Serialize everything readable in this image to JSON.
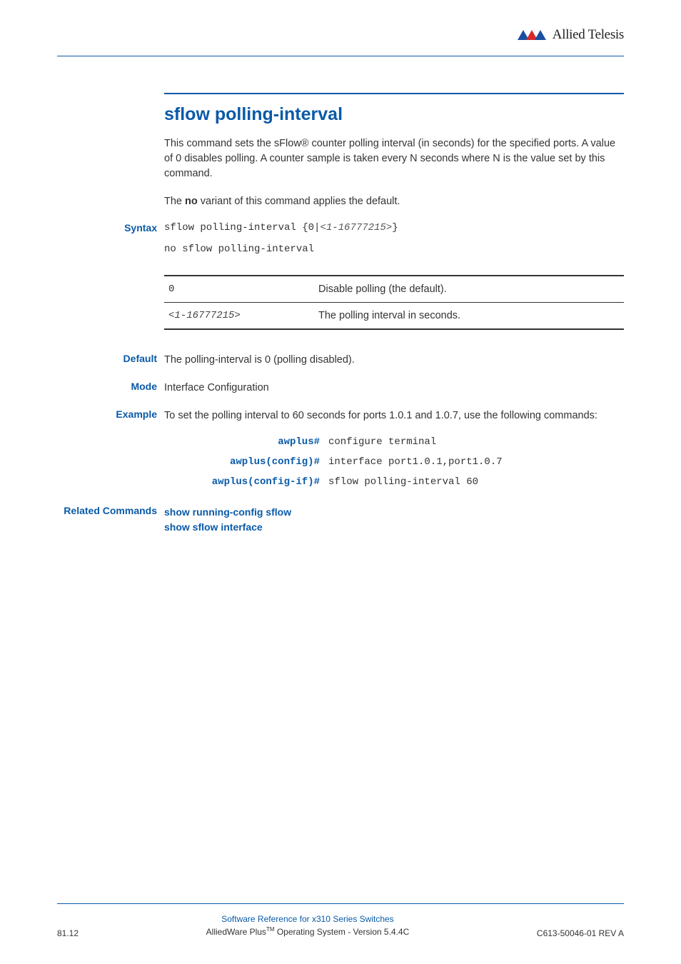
{
  "brand": {
    "name": "Allied Telesis"
  },
  "title": "sflow polling-interval",
  "intro_p1": "This command sets the sFlow® counter polling interval (in seconds) for the specified ports. A value of 0 disables polling. A counter sample is taken every N seconds where N is the value set by this command.",
  "intro_p2_pre": "The ",
  "intro_p2_bold": "no",
  "intro_p2_post": " variant of this command applies the default.",
  "labels": {
    "syntax": "Syntax",
    "default": "Default",
    "mode": "Mode",
    "example": "Example",
    "related": "Related Commands"
  },
  "syntax": {
    "line1_pre": "sflow polling-interval {0|",
    "line1_param": "<1-16777215>",
    "line1_post": "}",
    "line2": "no sflow polling-interval"
  },
  "param_rows": [
    {
      "c1_plain": "0",
      "c1_param": "",
      "c2": "Disable polling (the default)."
    },
    {
      "c1_plain": "",
      "c1_param": "<1-16777215>",
      "c2": "The polling interval in seconds."
    }
  ],
  "default_text": "The polling-interval is 0 (polling disabled).",
  "mode_text": "Interface Configuration",
  "example_text": "To set the polling interval to 60 seconds for ports 1.0.1 and 1.0.7, use the following commands:",
  "example_lines": [
    {
      "prompt": "awplus#",
      "cmd": "configure terminal"
    },
    {
      "prompt": "awplus(config)#",
      "cmd": "interface port1.0.1,port1.0.7"
    },
    {
      "prompt": "awplus(config-if)#",
      "cmd": "sflow polling-interval 60"
    }
  ],
  "related_links": [
    "show running-config sflow",
    "show sflow interface"
  ],
  "footer": {
    "left": "81.12",
    "center1": "Software Reference for x310 Series Switches",
    "center2_pre": "AlliedWare Plus",
    "center2_tm": "TM",
    "center2_post": " Operating System  - Version 5.4.4C",
    "right": "C613-50046-01 REV A"
  }
}
